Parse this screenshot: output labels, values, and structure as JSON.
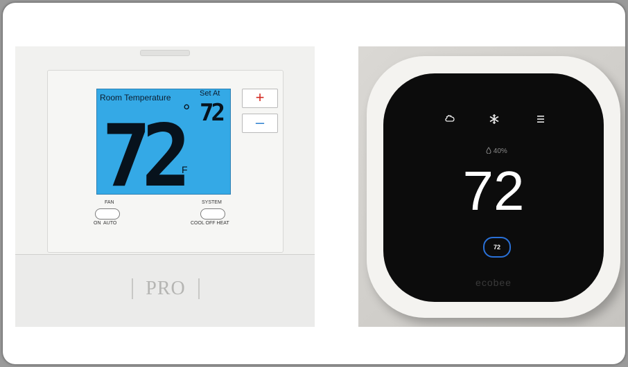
{
  "pro_thermostat": {
    "room_temperature_label": "Room Temperature",
    "set_at_label": "Set At",
    "room_temperature": "72",
    "set_temperature": "72",
    "degree_symbol": "°",
    "unit": "F",
    "plus_label": "+",
    "minus_label": "–",
    "fan_switch": {
      "label": "FAN",
      "options": "ON  AUTO"
    },
    "system_switch": {
      "label": "SYSTEM",
      "options": "COOL OFF HEAT"
    },
    "brand": "PRO"
  },
  "ecobee_thermostat": {
    "humidity": "40%",
    "temperature": "72",
    "setpoint": "72",
    "brand": "ecobee",
    "icons": [
      "weather-icon",
      "snowflake-icon",
      "menu-icon",
      "droplet-icon"
    ]
  }
}
